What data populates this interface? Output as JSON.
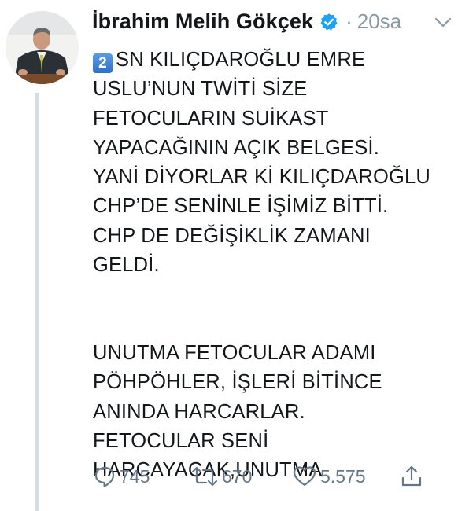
{
  "tweet": {
    "author_name": "İbrahim Melih Gökçek",
    "separator": "·",
    "timestamp": "20sa",
    "keycap_number": "2",
    "text": "SN KILIÇDAROĞLU EMRE\nUSLU’NUN TWİTİ SİZE\nFETOCULARIN SUİKAST\nYAPACAĞININ AÇIK BELGESİ.\nYANİ DİYORLAR Kİ KILIÇDAROĞLU\nCHP’DE SENİNLE İŞİMİZ BİTTİ.\nCHP DE DEĞİŞİKLİK ZAMANI\nGELDİ.\n\n\nUNUTMA FETOCULAR ADAMI\nPÖHPÖHLER, İŞLERİ BİTİNCE\nANINDA HARCARLAR.\nFETOCULAR SENİ\nHARCAYACAK,UNUTMA",
    "actions": {
      "reply_count": "745",
      "retweet_count": "670",
      "like_count": "5.575"
    }
  },
  "icons": {
    "verified": "verified-badge-icon",
    "caret": "chevron-down-icon",
    "reply": "reply-icon",
    "retweet": "retweet-icon",
    "like": "heart-icon",
    "share": "share-icon"
  },
  "colors": {
    "text": "#14171a",
    "muted": "#657786",
    "timestamp": "#8899a6",
    "verified": "#1da1f2",
    "thread_line": "#d6dde2"
  }
}
